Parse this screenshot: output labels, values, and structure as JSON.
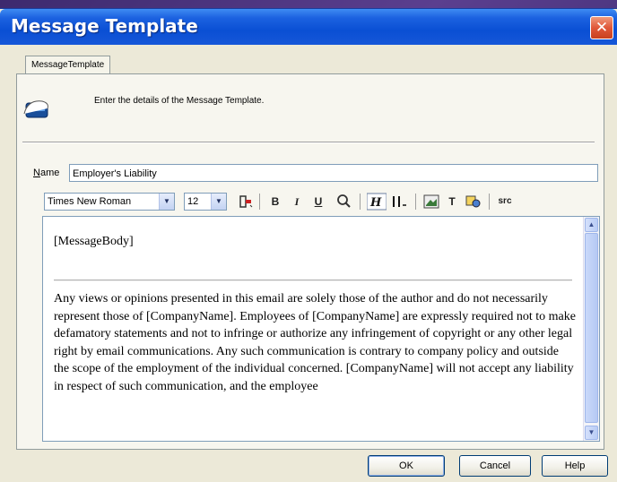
{
  "window": {
    "title": "Message Template",
    "close_glyph": "✕"
  },
  "tabs": [
    {
      "label": "MessageTemplate",
      "active": true
    }
  ],
  "header": {
    "icon": "message-template-icon",
    "instruction": "Enter the details of the Message Template."
  },
  "name_field": {
    "label_prefix": "N",
    "label_rest": "ame",
    "value": "Employer's Liability"
  },
  "toolbar": {
    "font_family": "Times New Roman",
    "font_size": "12",
    "bold": "B",
    "italic": "I",
    "underline": "U",
    "text_tool": "T",
    "source": "src"
  },
  "editor": {
    "placeholder": "[MessageBody]",
    "disclaimer": "Any views or opinions presented in this email are solely those of the author and do not necessarily represent those of [CompanyName]. Employees of [CompanyName] are expressly required not to make defamatory statements and not to infringe or authorize any infringement of copyright or any other legal right by email communications. Any such communication is contrary to company policy and outside the scope of the employment of the individual concerned. [CompanyName] will not accept any liability in respect of such communication, and the employee"
  },
  "buttons": {
    "ok": "OK",
    "cancel": "Cancel",
    "help": "Help"
  },
  "colors": {
    "titlebar": "#0a4fd4",
    "close": "#e0583a",
    "dialog_bg": "#ece9d8"
  }
}
